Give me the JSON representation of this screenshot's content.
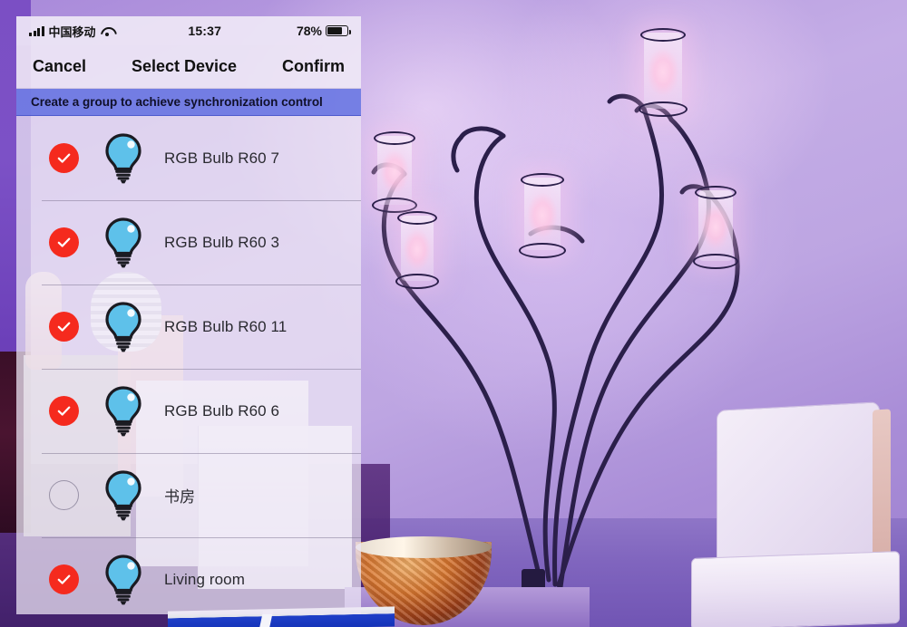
{
  "statusbar": {
    "signal_icon": "signal-bars-icon",
    "carrier": "中国移动",
    "wifi_icon": "wifi-icon",
    "time": "15:37",
    "battery_percent": "78%",
    "battery_icon": "battery-icon",
    "battery_level": 78
  },
  "navbar": {
    "cancel_label": "Cancel",
    "title": "Select Device",
    "confirm_label": "Confirm"
  },
  "banner": {
    "text": "Create a group to achieve synchronization control",
    "background_color": "#5c6ae0",
    "text_color": "#10102a"
  },
  "colors": {
    "checked": "#f52a1e",
    "unchecked_border": "#9a93a8",
    "bulb_fill": "#5ec1ea",
    "bulb_outline": "#1b1b22",
    "panel_background": "#ece6f4",
    "wall": "#b79ce0"
  },
  "devices": [
    {
      "name": "RGB Bulb R60 7",
      "icon": "light-bulb-icon",
      "selected": true,
      "check_icon": "check-circle-icon"
    },
    {
      "name": "RGB Bulb R60 3",
      "icon": "light-bulb-icon",
      "selected": true,
      "check_icon": "check-circle-icon"
    },
    {
      "name": "RGB Bulb R60 11",
      "icon": "light-bulb-icon",
      "selected": true,
      "check_icon": "check-circle-icon"
    },
    {
      "name": "RGB Bulb R60 6",
      "icon": "light-bulb-icon",
      "selected": true,
      "check_icon": "check-circle-icon"
    },
    {
      "name": "书房",
      "icon": "light-bulb-icon",
      "selected": false,
      "check_icon": "empty-circle-icon"
    },
    {
      "name": "Living room",
      "icon": "light-bulb-icon",
      "selected": true,
      "check_icon": "check-circle-icon"
    }
  ],
  "background_scene": {
    "description": "purple-lit living room wall with branching wire floor lamp, white armchair, mosaic bowl on table"
  }
}
